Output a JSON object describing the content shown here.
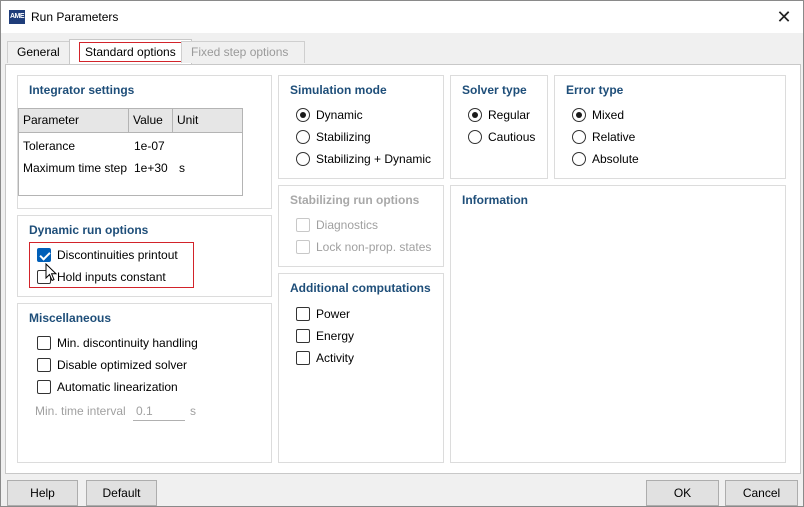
{
  "window": {
    "title": "Run Parameters",
    "icon_text": "AME",
    "close_glyph": "✕"
  },
  "tabs": [
    {
      "label": "General",
      "state": "normal"
    },
    {
      "label": "Standard options",
      "state": "active"
    },
    {
      "label": "Fixed step options",
      "state": "disabled"
    }
  ],
  "integrator": {
    "title": "Integrator settings",
    "columns": [
      "Parameter",
      "Value",
      "Unit"
    ],
    "rows": [
      {
        "parameter": "Tolerance",
        "value": "1e-07",
        "unit": ""
      },
      {
        "parameter": "Maximum time step",
        "value": "1e+30",
        "unit": "s"
      }
    ]
  },
  "dynamic_run": {
    "title": "Dynamic run options",
    "options": [
      {
        "label": "Discontinuities printout",
        "checked": true
      },
      {
        "label": "Hold inputs constant",
        "checked": false
      }
    ]
  },
  "misc": {
    "title": "Miscellaneous",
    "options": [
      {
        "label": "Min. discontinuity handling",
        "checked": false
      },
      {
        "label": "Disable optimized solver",
        "checked": false
      },
      {
        "label": "Automatic linearization",
        "checked": false
      }
    ],
    "min_interval_label": "Min. time interval",
    "min_interval_value": "0.1",
    "min_interval_unit": "s"
  },
  "sim_mode": {
    "title": "Simulation mode",
    "options": [
      {
        "label": "Dynamic",
        "selected": true
      },
      {
        "label": "Stabilizing",
        "selected": false
      },
      {
        "label": "Stabilizing + Dynamic",
        "selected": false
      }
    ]
  },
  "stab_run": {
    "title": "Stabilizing run options",
    "options": [
      {
        "label": "Diagnostics",
        "checked": false
      },
      {
        "label": "Lock non-prop. states",
        "checked": false
      }
    ]
  },
  "additional": {
    "title": "Additional computations",
    "options": [
      {
        "label": "Power",
        "checked": false
      },
      {
        "label": "Energy",
        "checked": false
      },
      {
        "label": "Activity",
        "checked": false
      }
    ]
  },
  "solver_type": {
    "title": "Solver type",
    "options": [
      {
        "label": "Regular",
        "selected": true
      },
      {
        "label": "Cautious",
        "selected": false
      }
    ]
  },
  "error_type": {
    "title": "Error type",
    "options": [
      {
        "label": "Mixed",
        "selected": true
      },
      {
        "label": "Relative",
        "selected": false
      },
      {
        "label": "Absolute",
        "selected": false
      }
    ]
  },
  "information": {
    "title": "Information"
  },
  "buttons": {
    "help": "Help",
    "default": "Default",
    "ok": "OK",
    "cancel": "Cancel"
  }
}
